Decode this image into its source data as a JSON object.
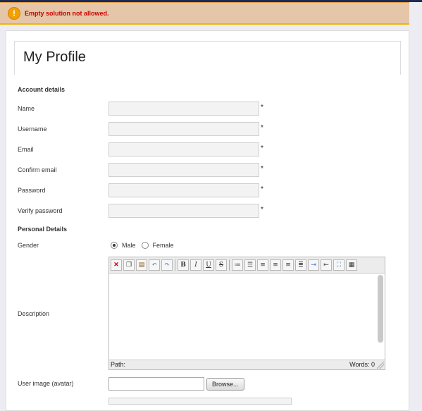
{
  "alert": {
    "icon": "exclamation-icon",
    "message": "Empty solution not allowed."
  },
  "page": {
    "title": "My Profile"
  },
  "account_section": {
    "heading": "Account details",
    "fields": [
      {
        "label": "Name",
        "value": "",
        "required": "*"
      },
      {
        "label": "Username",
        "value": "",
        "required": "*"
      },
      {
        "label": "Email",
        "value": "",
        "required": "*"
      },
      {
        "label": "Confirm email",
        "value": "",
        "required": "*"
      },
      {
        "label": "Password",
        "value": "",
        "required": "*"
      },
      {
        "label": "Verify password",
        "value": "",
        "required": "*"
      }
    ]
  },
  "personal_section": {
    "heading": "Personal Details",
    "gender": {
      "label": "Gender",
      "options": [
        "Male",
        "Female"
      ],
      "selected": "Male"
    },
    "description": {
      "label": "Description",
      "toolbar": {
        "buttons": [
          "cut-icon",
          "copy-icon",
          "paste-icon",
          "undo-icon",
          "redo-icon",
          "bold-icon",
          "italic-icon",
          "underline-icon",
          "strikethrough-icon",
          "ordered-list-icon",
          "unordered-list-icon",
          "align-left-icon",
          "align-center-icon",
          "align-right-icon",
          "align-justify-icon",
          "indent-icon",
          "outdent-icon",
          "fullscreen-icon",
          "table-icon"
        ],
        "bold_glyph": "B",
        "italic_glyph": "I",
        "underline_glyph": "U",
        "strike_glyph": "S"
      },
      "status": {
        "path": "Path:",
        "words": "Words: 0"
      }
    },
    "avatar": {
      "label": "User image (avatar)",
      "browse": "Browse..."
    }
  },
  "colors": {
    "alert_bg": "#e6c6a8",
    "alert_text": "#cc0000",
    "alert_icon": "#f2a100"
  }
}
